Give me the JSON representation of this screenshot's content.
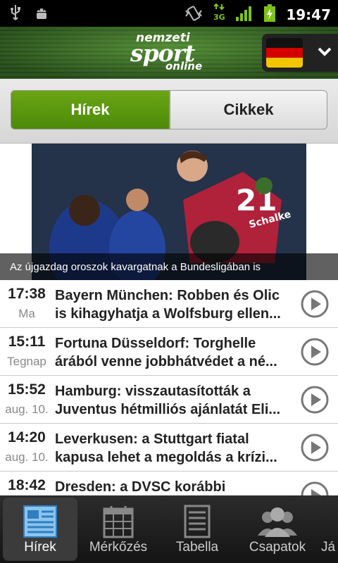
{
  "status_bar": {
    "time": "19:47",
    "network": "3G"
  },
  "header": {
    "logo_line1": "nemzeti",
    "logo_line2": "sport",
    "logo_line3": "online",
    "language_flag": "germany-flag"
  },
  "tabs": [
    {
      "label": "Hírek",
      "active": true
    },
    {
      "label": "Cikkek",
      "active": false
    }
  ],
  "hero": {
    "caption": "Az újgazdag oroszok kavargatnak a Bundesligában is",
    "jersey_number": "21",
    "jersey_name": "Schalke"
  },
  "news": [
    {
      "time": "17:38",
      "day": "Ma",
      "title_line1": "Bayern München: Robben és Olic",
      "title_line2": "is kihagyhatja a Wolfsburg ellen..."
    },
    {
      "time": "15:11",
      "day": "Tegnap",
      "title_line1": "Fortuna Düsseldorf: Torghelle",
      "title_line2": "árából venne jobbhátvédet a né..."
    },
    {
      "time": "15:52",
      "day": "aug. 10.",
      "title_line1": "Hamburg: visszautasították a",
      "title_line2": "Juventus hétmilliós ajánlatát Eli..."
    },
    {
      "time": "14:20",
      "day": "aug. 10.",
      "title_line1": "Leverkusen: a Stuttgart fiatal",
      "title_line2": "kapusa lehet a megoldás a krízi..."
    },
    {
      "time": "18:42",
      "day": "",
      "title_line1": "Dresden: a DVSC korábbi",
      "title_line2": ""
    }
  ],
  "bottom_nav": [
    {
      "label": "Hírek",
      "icon": "news-icon",
      "active": true
    },
    {
      "label": "Mérkőzés",
      "icon": "calendar-icon",
      "active": false
    },
    {
      "label": "Tabella",
      "icon": "table-icon",
      "active": false
    },
    {
      "label": "Csapatok",
      "icon": "teams-icon",
      "active": false
    },
    {
      "label": "Já",
      "icon": "players-icon",
      "active": false
    }
  ],
  "colors": {
    "accent_green": "#5a9a10",
    "status_bar": "#000000",
    "nav_bg": "#1e1e1e"
  }
}
